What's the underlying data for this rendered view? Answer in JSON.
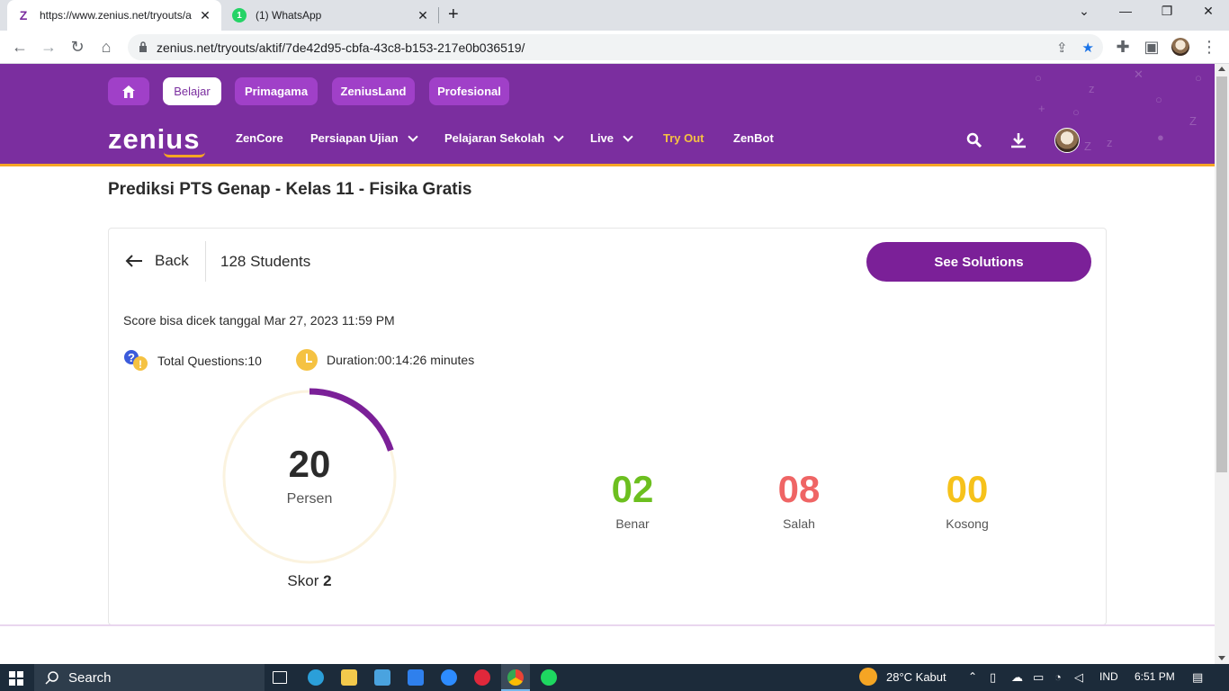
{
  "browser": {
    "tabs": [
      {
        "title": "https://www.zenius.net/tryouts/a",
        "favicon": "Z"
      },
      {
        "title": "(1) WhatsApp",
        "favicon": "1"
      }
    ],
    "url": "zenius.net/tryouts/aktif/7de42d95-cbfa-43c8-b153-217e0b036519/"
  },
  "header": {
    "pills": [
      "Belajar",
      "Primagama",
      "ZeniusLand",
      "Profesional"
    ],
    "logo": "zenius",
    "nav": [
      "ZenCore",
      "Persiapan Ujian",
      "Pelajaran Sekolah",
      "Live",
      "Try Out",
      "ZenBot"
    ]
  },
  "page": {
    "title": "Prediksi PTS Genap - Kelas 11 - Fisika Gratis",
    "back_label": "Back",
    "students": "128 Students",
    "solutions_button": "See Solutions",
    "score_date": "Score bisa dicek tanggal Mar 27, 2023 11:59 PM",
    "total_questions": "Total Questions:10",
    "duration": "Duration:00:14:26 minutes",
    "gauge": {
      "value": "20",
      "unit": "Persen",
      "percent": 20
    },
    "skor_label": "Skor",
    "skor_value": "2",
    "results": [
      {
        "value": "02",
        "label": "Benar",
        "color": "#6cbf1f"
      },
      {
        "value": "08",
        "label": "Salah",
        "color": "#ef6565"
      },
      {
        "value": "00",
        "label": "Kosong",
        "color": "#f6c21b"
      }
    ]
  },
  "colors": {
    "brand": "#7b2e9f",
    "accent": "#f5a524",
    "button": "#7b2098"
  },
  "taskbar": {
    "search": "Search",
    "weather": "28°C  Kabut",
    "lang": "IND",
    "time": "6:51 PM"
  }
}
